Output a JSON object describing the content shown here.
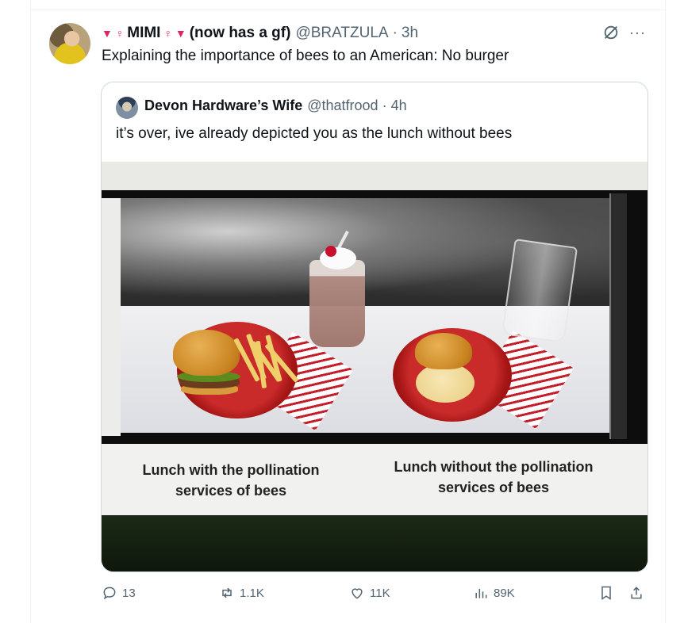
{
  "tweet": {
    "author": {
      "name_symbol_left": "▼ ♀",
      "name": "MIMI",
      "name_symbol_right": "♀ ▼",
      "name_suffix": "(now has a gf)",
      "handle": "@BRATZULA",
      "time": "3h"
    },
    "text": "Explaining the importance of bees to an American: No burger",
    "icons": {
      "grok": "grok-icon",
      "more": "more-icon",
      "more_glyph": "···"
    }
  },
  "quote": {
    "author": {
      "name": "Devon Hardware’s Wife",
      "handle": "@thatfrood",
      "time": "4h"
    },
    "text": "it’s over, ive already depicted you as the lunch without bees",
    "image": {
      "label_left": "Lunch with the pollination services of bees",
      "label_right": "Lunch without the pollination services of bees"
    }
  },
  "actions": {
    "replies": "13",
    "reposts": "1.1K",
    "likes": "11K",
    "views": "89K"
  },
  "colors": {
    "text": "#0f1419",
    "muted": "#536471",
    "border": "#cfd9de",
    "accent_triangle": "#e0245e"
  }
}
